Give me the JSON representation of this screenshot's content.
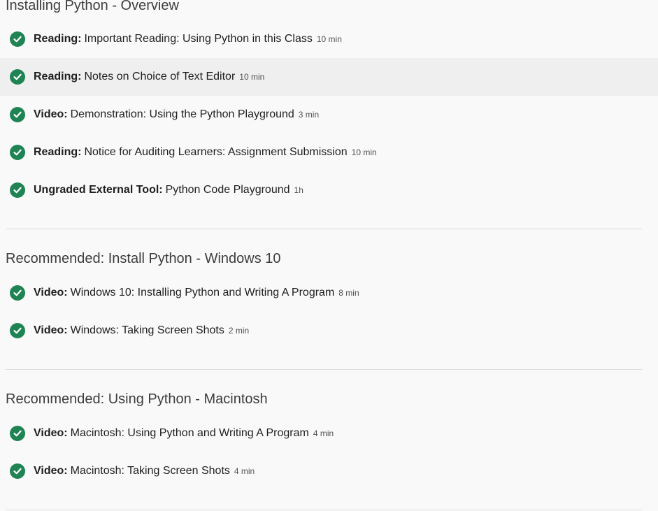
{
  "sections": [
    {
      "title": "Installing Python - Overview",
      "items": [
        {
          "kind": "Reading:",
          "title": "Important Reading: Using Python in this Class",
          "duration": "10 min",
          "completed": true
        },
        {
          "kind": "Reading:",
          "title": "Notes on Choice of Text Editor",
          "duration": "10 min",
          "completed": true,
          "hovered": true
        },
        {
          "kind": "Video:",
          "title": "Demonstration: Using the Python Playground",
          "duration": "3 min",
          "completed": true
        },
        {
          "kind": "Reading:",
          "title": "Notice for Auditing Learners: Assignment Submission",
          "duration": "10 min",
          "completed": true
        },
        {
          "kind": "Ungraded External Tool:",
          "title": "Python Code Playground",
          "duration": "1h",
          "completed": true
        }
      ]
    },
    {
      "title": "Recommended: Install Python - Windows 10",
      "items": [
        {
          "kind": "Video:",
          "title": "Windows 10: Installing Python and Writing A Program",
          "duration": "8 min",
          "completed": true
        },
        {
          "kind": "Video:",
          "title": "Windows: Taking Screen Shots",
          "duration": "2 min",
          "completed": true
        }
      ]
    },
    {
      "title": "Recommended: Using Python - Macintosh",
      "items": [
        {
          "kind": "Video:",
          "title": "Macintosh: Using Python and Writing A Program",
          "duration": "4 min",
          "completed": true
        },
        {
          "kind": "Video:",
          "title": "Macintosh: Taking Screen Shots",
          "duration": "4 min",
          "completed": true
        }
      ]
    }
  ],
  "colors": {
    "completed_check": "#1f8354",
    "hover_row": "#efefef",
    "background": "#f9f9f9"
  },
  "icons": {
    "completed": "check-circle-icon"
  }
}
